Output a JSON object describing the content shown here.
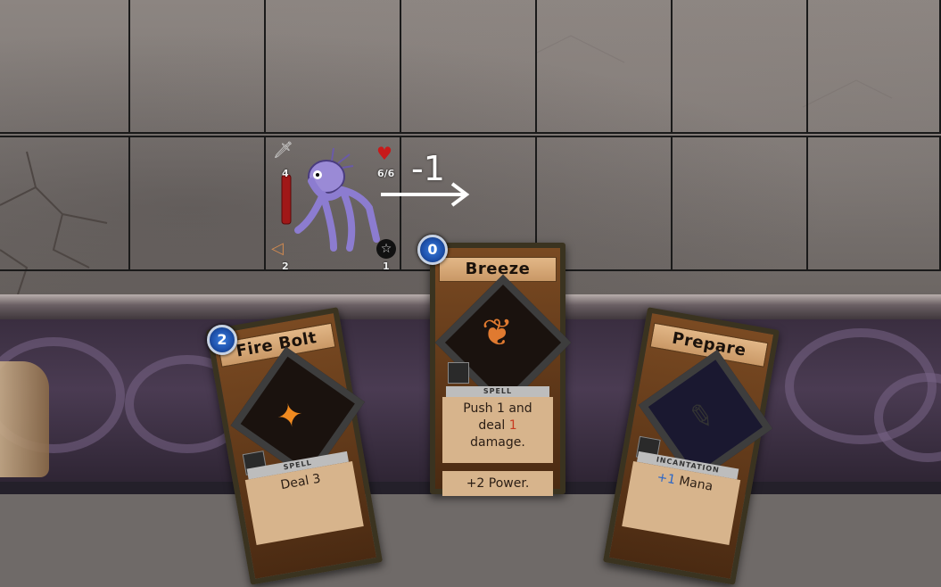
{
  "monster": {
    "name": "purple-imp",
    "attack": "4",
    "health": "6/6",
    "move": "2",
    "special": "1"
  },
  "intent": {
    "push_value": "-1"
  },
  "cards": [
    {
      "id": "fire_bolt",
      "title": "Fire Bolt",
      "cost": "2",
      "type": "SPELL",
      "text_line1": "Deal 3",
      "text_line2": ""
    },
    {
      "id": "breeze",
      "title": "Breeze",
      "cost": "0",
      "type": "SPELL",
      "text_line1": "Push 1 and",
      "text_line2": "deal",
      "text_num": "1",
      "text_line3": "damage.",
      "extra": "+2 Power."
    },
    {
      "id": "prepare",
      "title": "Prepare",
      "cost": "",
      "type": "INCANTATION",
      "text_prefix": "+1",
      "text_line1": "Mana"
    }
  ],
  "colors": {
    "accent_red": "#c83a20",
    "cost_blue": "#2a66c8",
    "heart_red": "#c81a1a"
  }
}
